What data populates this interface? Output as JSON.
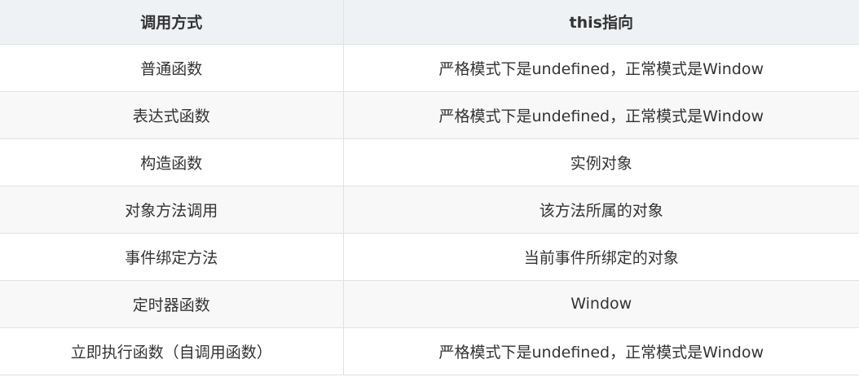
{
  "table": {
    "headers": [
      "调用方式",
      "this指向"
    ],
    "rows": [
      [
        "普通函数",
        "严格模式下是undefined，正常模式是Window"
      ],
      [
        "表达式函数",
        "严格模式下是undefined，正常模式是Window"
      ],
      [
        "构造函数",
        "实例对象"
      ],
      [
        "对象方法调用",
        "该方法所属的对象"
      ],
      [
        "事件绑定方法",
        "当前事件所绑定的对象"
      ],
      [
        "定时器函数",
        "Window"
      ],
      [
        "立即执行函数（自调用函数）",
        "严格模式下是undefined，正常模式是Window"
      ]
    ]
  },
  "colors": {
    "header_bg": "#eff2f5",
    "row_alt_bg": "#f8f8f8",
    "border": "#dfe2e5",
    "text": "#333333"
  }
}
